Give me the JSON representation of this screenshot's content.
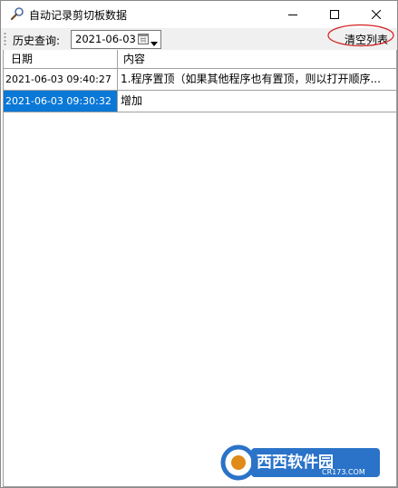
{
  "window": {
    "title": "自动记录剪切板数据",
    "title_icon": "magnifier-icon",
    "controls": [
      "minimize-icon",
      "maximize-icon",
      "close-icon"
    ]
  },
  "toolbar": {
    "history_label": "历史查询:",
    "date_value": "2021-06-03",
    "calendar_icon": "calendar-icon",
    "dropdown_icon": "chevron-down-icon",
    "clear_label": "清空列表",
    "clear_highlight_color": "#d42020"
  },
  "grid": {
    "columns": [
      "日期",
      "内容"
    ],
    "rows": [
      {
        "date": "2021-06-03 09:40:27",
        "content": "1.程序置顶（如果其他程序也有置顶，则以打开顺序...",
        "selected": false
      },
      {
        "date": "2021-06-03 09:30:32",
        "content": "增加",
        "selected": true
      }
    ],
    "selection_color": "#0a78d7"
  },
  "watermark": {
    "brand": "西西软件园",
    "site": "CR173.COM"
  }
}
